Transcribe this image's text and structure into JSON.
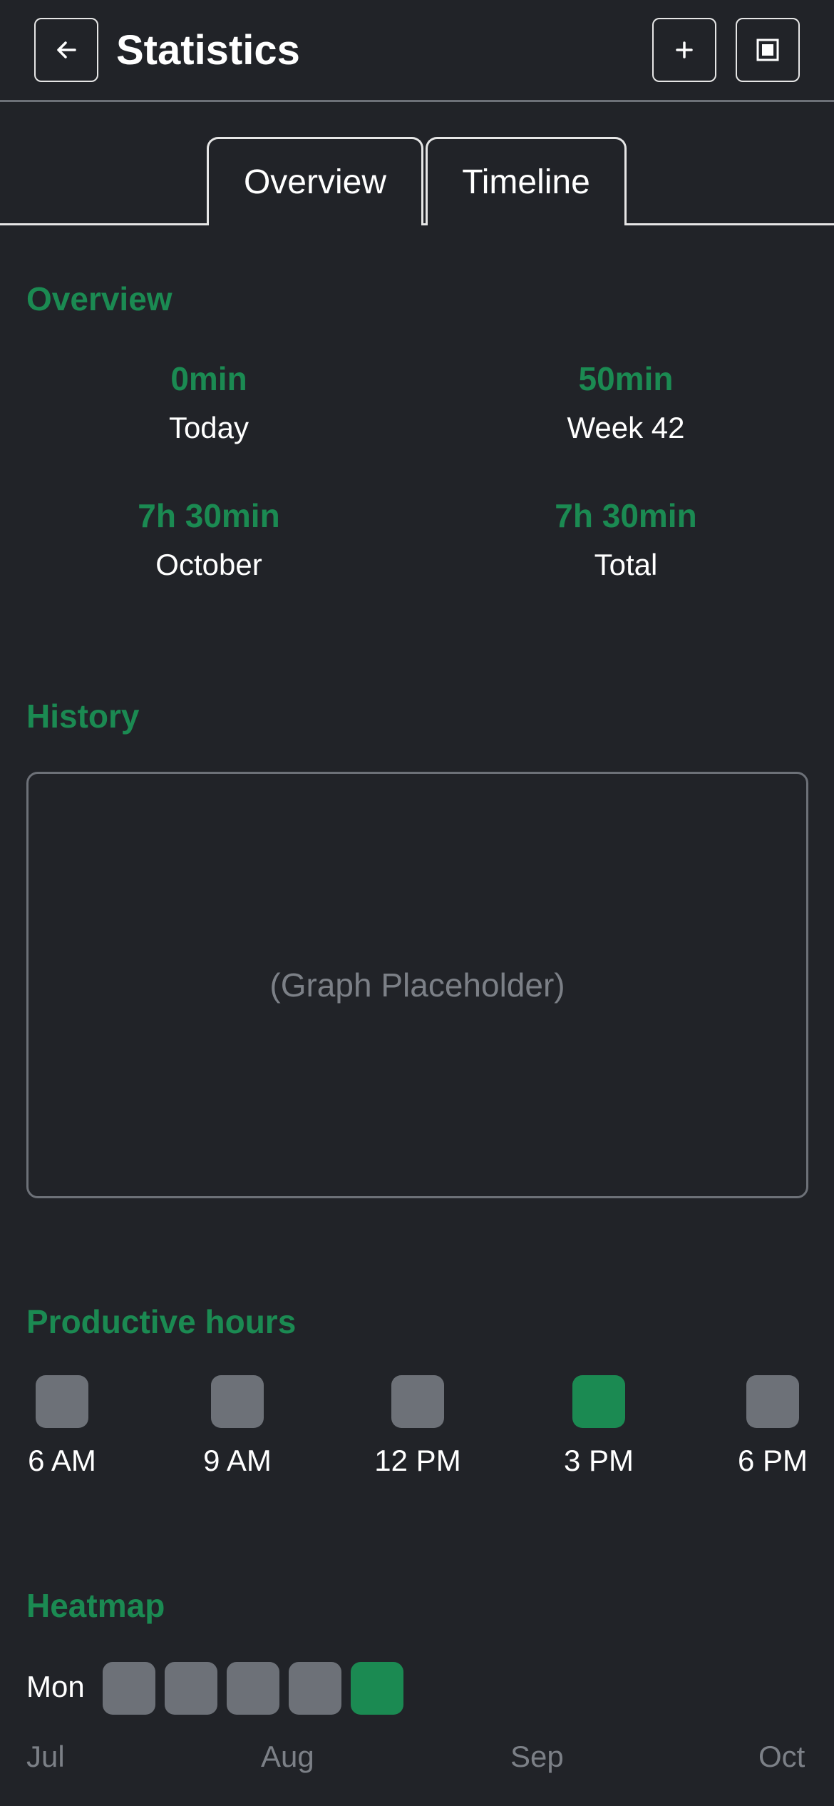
{
  "header": {
    "title": "Statistics",
    "back_icon": "arrow-left-icon",
    "add_icon": "plus-icon",
    "stop_icon": "stop-square-icon"
  },
  "tabs": [
    {
      "label": "Overview",
      "selected": true
    },
    {
      "label": "Timeline",
      "selected": false
    }
  ],
  "overview": {
    "title": "Overview",
    "stats": [
      {
        "value": "0min",
        "label": "Today"
      },
      {
        "value": "50min",
        "label": "Week 42"
      },
      {
        "value": "7h 30min",
        "label": "October"
      },
      {
        "value": "7h 30min",
        "label": "Total"
      }
    ]
  },
  "history": {
    "title": "History",
    "placeholder": "(Graph Placeholder)"
  },
  "productive_hours": {
    "title": "Productive hours",
    "hours": [
      {
        "label": "6 AM",
        "active": false
      },
      {
        "label": "9 AM",
        "active": false
      },
      {
        "label": "12 PM",
        "active": false
      },
      {
        "label": "3 PM",
        "active": true
      },
      {
        "label": "6 PM",
        "active": false
      }
    ]
  },
  "heatmap": {
    "title": "Heatmap",
    "row_label": "Mon",
    "cells": [
      false,
      false,
      false,
      false,
      true
    ],
    "months": [
      "Jul",
      "Aug",
      "Sep",
      "Oct"
    ]
  },
  "colors": {
    "background": "#212328",
    "accent": "#1b8a52",
    "inactive": "#6d7178",
    "muted_text": "#7c8087"
  }
}
